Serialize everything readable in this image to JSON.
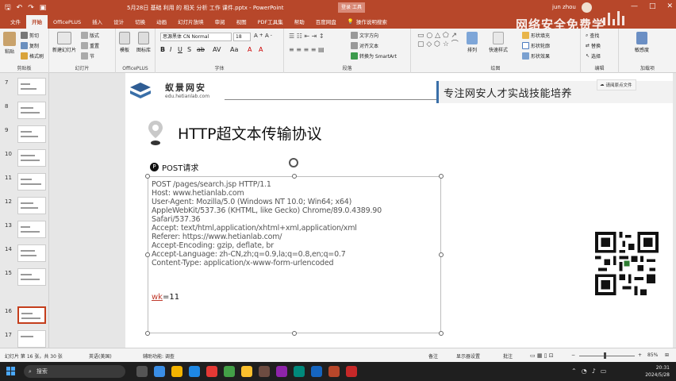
{
  "window": {
    "title": "5月28日 基础 利用 的 相关 分析 工作 课件.pptx - PowerPoint",
    "sync_badge": "登录 工具",
    "user_name": "jun zhou",
    "watermark": "网络安全免费学"
  },
  "ribbon": {
    "tabs": [
      "文件",
      "开始",
      "OfficePLUS",
      "插入",
      "设计",
      "切换",
      "动画",
      "幻灯片放映",
      "审阅",
      "视图",
      "PDF工具集",
      "帮助",
      "百度网盘"
    ],
    "active_tab": "开始",
    "search_label": "操作说明搜索",
    "groups": {
      "clipboard": {
        "label": "剪贴板",
        "paste": "粘贴",
        "cut": "剪切",
        "copy": "复制",
        "format_painter": "格式刷"
      },
      "slides": {
        "label": "幻灯片",
        "new_slide": "新建幻灯片",
        "layout": "版式",
        "reset": "重置",
        "section": "节"
      },
      "officeplus": {
        "label": "OfficePLUS",
        "templates": "模板",
        "library": "图标库"
      },
      "font": {
        "label": "字体",
        "font_name": "思源黑体 CN Normal",
        "font_size": "18"
      },
      "paragraph": {
        "label": "段落",
        "text_direction": "文字方向",
        "align_text": "对齐文本",
        "smartart": "转换为 SmartArt"
      },
      "drawing": {
        "label": "绘图",
        "shapes": "形状",
        "arrange": "排列",
        "quick_styles": "快速样式",
        "shape_fill": "形状填充",
        "shape_outline": "形状轮廓",
        "shape_effects": "形状效果"
      },
      "editing": {
        "label": "编辑",
        "find": "查找",
        "replace": "替换",
        "select": "选择"
      },
      "addins": {
        "label": "加载项",
        "sensitivity": "敏感度"
      }
    }
  },
  "thumbnails": [
    {
      "num": "7"
    },
    {
      "num": "8"
    },
    {
      "num": "9"
    },
    {
      "num": "10"
    },
    {
      "num": "11"
    },
    {
      "num": "12"
    },
    {
      "num": "13"
    },
    {
      "num": "14"
    },
    {
      "num": "15"
    },
    {
      "num": "16"
    },
    {
      "num": "17"
    }
  ],
  "slide": {
    "brand_name": "蚁景网安",
    "brand_url": "edu.hetianlab.com",
    "slogan": "专注网安人才实战技能培养",
    "upload_label": "请阅原点文件",
    "title": "HTTP超文本传输协议",
    "post_heading": "POST请求",
    "request_lines": [
      "POST /pages/search.jsp HTTP/1.1",
      "Host: www.hetianlab.com",
      "User-Agent: Mozilla/5.0 (Windows NT 10.0; Win64; x64)",
      "AppleWebKit/537.36 (KHTML, like Gecko) Chrome/89.0.4389.90",
      "Safari/537.36",
      "Accept: text/html,application/xhtml+xml,application/xml",
      "Referer: https://www.hetianlab.com/",
      "Accept-Encoding: gzip, deflate, br",
      "Accept-Language: zh-CN,zh;q=0.9,la;q=0.8,en;q=0.7",
      "Content-Type: application/x-www-form-urlencoded"
    ],
    "body_key": "wk",
    "body_rest": "=11"
  },
  "statusbar": {
    "slide_info": "幻灯片 第 16 张，共 30 张",
    "language": "英语(美国)",
    "accessibility": "辅助功能: 调查",
    "notes": "备注",
    "display_settings": "显示器设置",
    "comments": "批注",
    "zoom": "85%"
  },
  "taskbar": {
    "search": "搜索",
    "time": "20:31",
    "date": "2024/5/28"
  },
  "colors": {
    "accent": "#b7472a",
    "selection": "#c43e1c"
  }
}
